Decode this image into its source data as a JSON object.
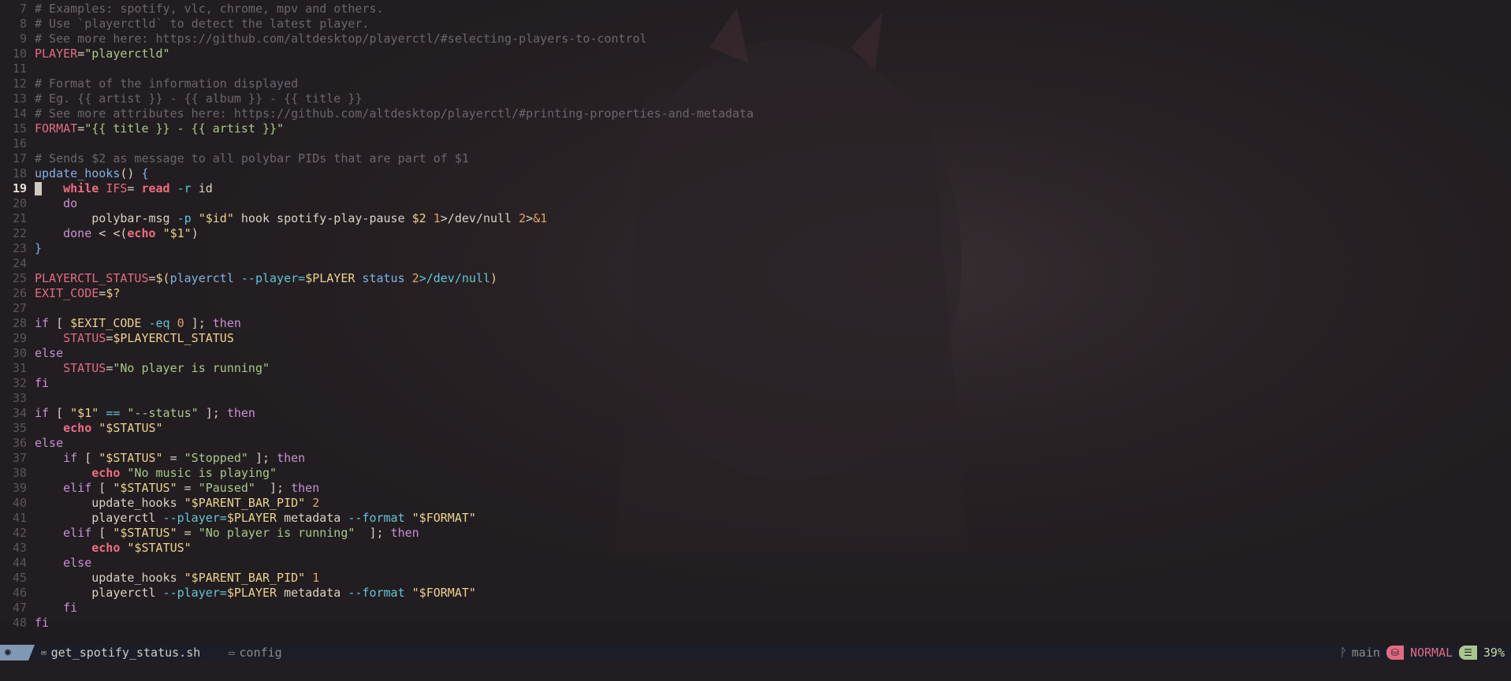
{
  "editor": {
    "current_line": 19,
    "lines": [
      {
        "n": "7",
        "segs": [
          {
            "c": "k-cmt",
            "t": "# Examples: spotify, vlc, chrome, mpv and others."
          }
        ]
      },
      {
        "n": "8",
        "segs": [
          {
            "c": "k-cmt",
            "t": "# Use `playerctld` to detect the latest player."
          }
        ]
      },
      {
        "n": "9",
        "segs": [
          {
            "c": "k-cmt",
            "t": "# See more here: https://github.com/altdesktop/playerctl/#selecting-players-to-control"
          }
        ]
      },
      {
        "n": "10",
        "segs": [
          {
            "c": "k-var",
            "t": "PLAYER"
          },
          {
            "c": "k-pl",
            "t": "="
          },
          {
            "c": "k-str",
            "t": "\"playerctld\""
          }
        ]
      },
      {
        "n": "11",
        "segs": []
      },
      {
        "n": "12",
        "segs": [
          {
            "c": "k-cmt",
            "t": "# Format of the information displayed"
          }
        ]
      },
      {
        "n": "13",
        "segs": [
          {
            "c": "k-cmt",
            "t": "# Eg. {{ artist }} - {{ album }} - {{ title }}"
          }
        ]
      },
      {
        "n": "14",
        "segs": [
          {
            "c": "k-cmt",
            "t": "# See more attributes here: https://github.com/altdesktop/playerctl/#printing-properties-and-metadata"
          }
        ]
      },
      {
        "n": "15",
        "segs": [
          {
            "c": "k-var",
            "t": "FORMAT"
          },
          {
            "c": "k-pl",
            "t": "="
          },
          {
            "c": "k-str",
            "t": "\"{{ title }} - {{ artist }}\""
          }
        ]
      },
      {
        "n": "16",
        "segs": []
      },
      {
        "n": "17",
        "segs": [
          {
            "c": "k-cmt",
            "t": "# Sends $2 as message to all polybar PIDs that are part of $1"
          }
        ]
      },
      {
        "n": "18",
        "segs": [
          {
            "c": "k-fn",
            "t": "update_hooks"
          },
          {
            "c": "k-pl",
            "t": "() "
          },
          {
            "c": "k-fn",
            "t": "{"
          }
        ]
      },
      {
        "n": "19",
        "cursor": true,
        "segs": [
          {
            "c": "k-pl",
            "t": "    "
          },
          {
            "c": "k-bi",
            "t": "while"
          },
          {
            "c": "k-pl",
            "t": " "
          },
          {
            "c": "k-var",
            "t": "IFS"
          },
          {
            "c": "k-pl",
            "t": "= "
          },
          {
            "c": "k-bi",
            "t": "read"
          },
          {
            "c": "k-op",
            "t": " -r"
          },
          {
            "c": "k-pl",
            "t": " id"
          }
        ]
      },
      {
        "n": "20",
        "segs": [
          {
            "c": "k-pl",
            "t": "    "
          },
          {
            "c": "k-kw",
            "t": "do"
          }
        ]
      },
      {
        "n": "21",
        "segs": [
          {
            "c": "k-pl",
            "t": "        polybar-msg "
          },
          {
            "c": "k-op",
            "t": "-p"
          },
          {
            "c": "k-pl",
            "t": " "
          },
          {
            "c": "k-str2",
            "t": "\"$id\""
          },
          {
            "c": "k-pl",
            "t": " hook spotify-play-pause "
          },
          {
            "c": "k-str2",
            "t": "$2"
          },
          {
            "c": "k-pl",
            "t": " "
          },
          {
            "c": "k-num",
            "t": "1"
          },
          {
            "c": "k-pl",
            "t": ">/dev/null "
          },
          {
            "c": "k-num",
            "t": "2"
          },
          {
            "c": "k-pl",
            "t": ">"
          },
          {
            "c": "k-num",
            "t": "&1"
          }
        ]
      },
      {
        "n": "22",
        "segs": [
          {
            "c": "k-pl",
            "t": "    "
          },
          {
            "c": "k-kw",
            "t": "done"
          },
          {
            "c": "k-pl",
            "t": " < <("
          },
          {
            "c": "k-bi",
            "t": "echo"
          },
          {
            "c": "k-pl",
            "t": " "
          },
          {
            "c": "k-str2",
            "t": "\"$1\""
          },
          {
            "c": "k-pl",
            "t": ")"
          }
        ]
      },
      {
        "n": "23",
        "segs": [
          {
            "c": "k-fn",
            "t": "}"
          }
        ]
      },
      {
        "n": "24",
        "segs": []
      },
      {
        "n": "25",
        "segs": [
          {
            "c": "k-var",
            "t": "PLAYERCTL_STATUS"
          },
          {
            "c": "k-pl",
            "t": "="
          },
          {
            "c": "k-str2",
            "t": "$("
          },
          {
            "c": "k-fn",
            "t": "playerctl"
          },
          {
            "c": "k-op",
            "t": " --player="
          },
          {
            "c": "k-str2",
            "t": "$PLAYER"
          },
          {
            "c": "k-fn",
            "t": " status"
          },
          {
            "c": "k-pl",
            "t": " "
          },
          {
            "c": "k-num",
            "t": "2"
          },
          {
            "c": "k-op",
            "t": ">/dev/null"
          },
          {
            "c": "k-str2",
            "t": ")"
          }
        ]
      },
      {
        "n": "26",
        "segs": [
          {
            "c": "k-var",
            "t": "EXIT_CODE"
          },
          {
            "c": "k-pl",
            "t": "="
          },
          {
            "c": "k-str2",
            "t": "$?"
          }
        ]
      },
      {
        "n": "27",
        "segs": []
      },
      {
        "n": "28",
        "segs": [
          {
            "c": "k-kw",
            "t": "if"
          },
          {
            "c": "k-pl",
            "t": " [ "
          },
          {
            "c": "k-str2",
            "t": "$EXIT_CODE"
          },
          {
            "c": "k-op",
            "t": " -eq"
          },
          {
            "c": "k-pl",
            "t": " "
          },
          {
            "c": "k-num",
            "t": "0"
          },
          {
            "c": "k-pl",
            "t": " ]; "
          },
          {
            "c": "k-kw",
            "t": "then"
          }
        ]
      },
      {
        "n": "29",
        "segs": [
          {
            "c": "k-pl",
            "t": "    "
          },
          {
            "c": "k-var",
            "t": "STATUS"
          },
          {
            "c": "k-pl",
            "t": "="
          },
          {
            "c": "k-str2",
            "t": "$PLAYERCTL_STATUS"
          }
        ]
      },
      {
        "n": "30",
        "segs": [
          {
            "c": "k-kw",
            "t": "else"
          }
        ]
      },
      {
        "n": "31",
        "segs": [
          {
            "c": "k-pl",
            "t": "    "
          },
          {
            "c": "k-var",
            "t": "STATUS"
          },
          {
            "c": "k-pl",
            "t": "="
          },
          {
            "c": "k-str",
            "t": "\"No player is running\""
          }
        ]
      },
      {
        "n": "32",
        "segs": [
          {
            "c": "k-kw",
            "t": "fi"
          }
        ]
      },
      {
        "n": "33",
        "segs": []
      },
      {
        "n": "34",
        "segs": [
          {
            "c": "k-kw",
            "t": "if"
          },
          {
            "c": "k-pl",
            "t": " [ "
          },
          {
            "c": "k-str2",
            "t": "\"$1\""
          },
          {
            "c": "k-pl",
            "t": " "
          },
          {
            "c": "k-op",
            "t": "=="
          },
          {
            "c": "k-pl",
            "t": " "
          },
          {
            "c": "k-str",
            "t": "\"--status\""
          },
          {
            "c": "k-pl",
            "t": " ]; "
          },
          {
            "c": "k-kw",
            "t": "then"
          }
        ]
      },
      {
        "n": "35",
        "segs": [
          {
            "c": "k-pl",
            "t": "    "
          },
          {
            "c": "k-bi",
            "t": "echo"
          },
          {
            "c": "k-pl",
            "t": " "
          },
          {
            "c": "k-str2",
            "t": "\"$STATUS\""
          }
        ]
      },
      {
        "n": "36",
        "segs": [
          {
            "c": "k-kw",
            "t": "else"
          }
        ]
      },
      {
        "n": "37",
        "segs": [
          {
            "c": "k-pl",
            "t": "    "
          },
          {
            "c": "k-kw",
            "t": "if"
          },
          {
            "c": "k-pl",
            "t": " [ "
          },
          {
            "c": "k-str2",
            "t": "\"$STATUS\""
          },
          {
            "c": "k-pl",
            "t": " = "
          },
          {
            "c": "k-str",
            "t": "\"Stopped\""
          },
          {
            "c": "k-pl",
            "t": " ]; "
          },
          {
            "c": "k-kw",
            "t": "then"
          }
        ]
      },
      {
        "n": "38",
        "segs": [
          {
            "c": "k-pl",
            "t": "        "
          },
          {
            "c": "k-bi",
            "t": "echo"
          },
          {
            "c": "k-pl",
            "t": " "
          },
          {
            "c": "k-str",
            "t": "\"No music is playing\""
          }
        ]
      },
      {
        "n": "39",
        "segs": [
          {
            "c": "k-pl",
            "t": "    "
          },
          {
            "c": "k-kw",
            "t": "elif"
          },
          {
            "c": "k-pl",
            "t": " [ "
          },
          {
            "c": "k-str2",
            "t": "\"$STATUS\""
          },
          {
            "c": "k-pl",
            "t": " = "
          },
          {
            "c": "k-str",
            "t": "\"Paused\""
          },
          {
            "c": "k-pl",
            "t": "  ]; "
          },
          {
            "c": "k-kw",
            "t": "then"
          }
        ]
      },
      {
        "n": "40",
        "segs": [
          {
            "c": "k-pl",
            "t": "        update_hooks "
          },
          {
            "c": "k-str2",
            "t": "\"$PARENT_BAR_PID\""
          },
          {
            "c": "k-pl",
            "t": " "
          },
          {
            "c": "k-num",
            "t": "2"
          }
        ]
      },
      {
        "n": "41",
        "segs": [
          {
            "c": "k-pl",
            "t": "        playerctl "
          },
          {
            "c": "k-op",
            "t": "--player="
          },
          {
            "c": "k-str2",
            "t": "$PLAYER"
          },
          {
            "c": "k-pl",
            "t": " metadata "
          },
          {
            "c": "k-op",
            "t": "--format"
          },
          {
            "c": "k-pl",
            "t": " "
          },
          {
            "c": "k-str2",
            "t": "\"$FORMAT\""
          }
        ]
      },
      {
        "n": "42",
        "segs": [
          {
            "c": "k-pl",
            "t": "    "
          },
          {
            "c": "k-kw",
            "t": "elif"
          },
          {
            "c": "k-pl",
            "t": " [ "
          },
          {
            "c": "k-str2",
            "t": "\"$STATUS\""
          },
          {
            "c": "k-pl",
            "t": " = "
          },
          {
            "c": "k-str",
            "t": "\"No player is running\""
          },
          {
            "c": "k-pl",
            "t": "  ]; "
          },
          {
            "c": "k-kw",
            "t": "then"
          }
        ]
      },
      {
        "n": "43",
        "segs": [
          {
            "c": "k-pl",
            "t": "        "
          },
          {
            "c": "k-bi",
            "t": "echo"
          },
          {
            "c": "k-pl",
            "t": " "
          },
          {
            "c": "k-str2",
            "t": "\"$STATUS\""
          }
        ]
      },
      {
        "n": "44",
        "segs": [
          {
            "c": "k-pl",
            "t": "    "
          },
          {
            "c": "k-kw",
            "t": "else"
          }
        ]
      },
      {
        "n": "45",
        "segs": [
          {
            "c": "k-pl",
            "t": "        update_hooks "
          },
          {
            "c": "k-str2",
            "t": "\"$PARENT_BAR_PID\""
          },
          {
            "c": "k-pl",
            "t": " "
          },
          {
            "c": "k-num",
            "t": "1"
          }
        ]
      },
      {
        "n": "46",
        "segs": [
          {
            "c": "k-pl",
            "t": "        playerctl "
          },
          {
            "c": "k-op",
            "t": "--player="
          },
          {
            "c": "k-str2",
            "t": "$PLAYER"
          },
          {
            "c": "k-pl",
            "t": " metadata "
          },
          {
            "c": "k-op",
            "t": "--format"
          },
          {
            "c": "k-pl",
            "t": " "
          },
          {
            "c": "k-str2",
            "t": "\"$FORMAT\""
          }
        ]
      },
      {
        "n": "47",
        "segs": [
          {
            "c": "k-pl",
            "t": "    "
          },
          {
            "c": "k-kw",
            "t": "fi"
          }
        ]
      },
      {
        "n": "48",
        "segs": [
          {
            "c": "k-kw",
            "t": "fi"
          }
        ]
      }
    ]
  },
  "statusbar": {
    "mode_icon": "vim-icon",
    "file_icon": "file-icon",
    "filename": "get_spotify_status.sh",
    "dir_icon": "folder-icon",
    "directory": "config",
    "branch_icon": "git-branch-icon",
    "branch": "main",
    "mode_badge_icon": "mode-icon",
    "mode": "NORMAL",
    "progress_icon": "progress-icon",
    "percent": "39%"
  },
  "colors": {
    "background": "#221d20",
    "statusbar": "#1b1e26",
    "mode_accent": "#e26a85",
    "percent_accent": "#a9c68e"
  }
}
